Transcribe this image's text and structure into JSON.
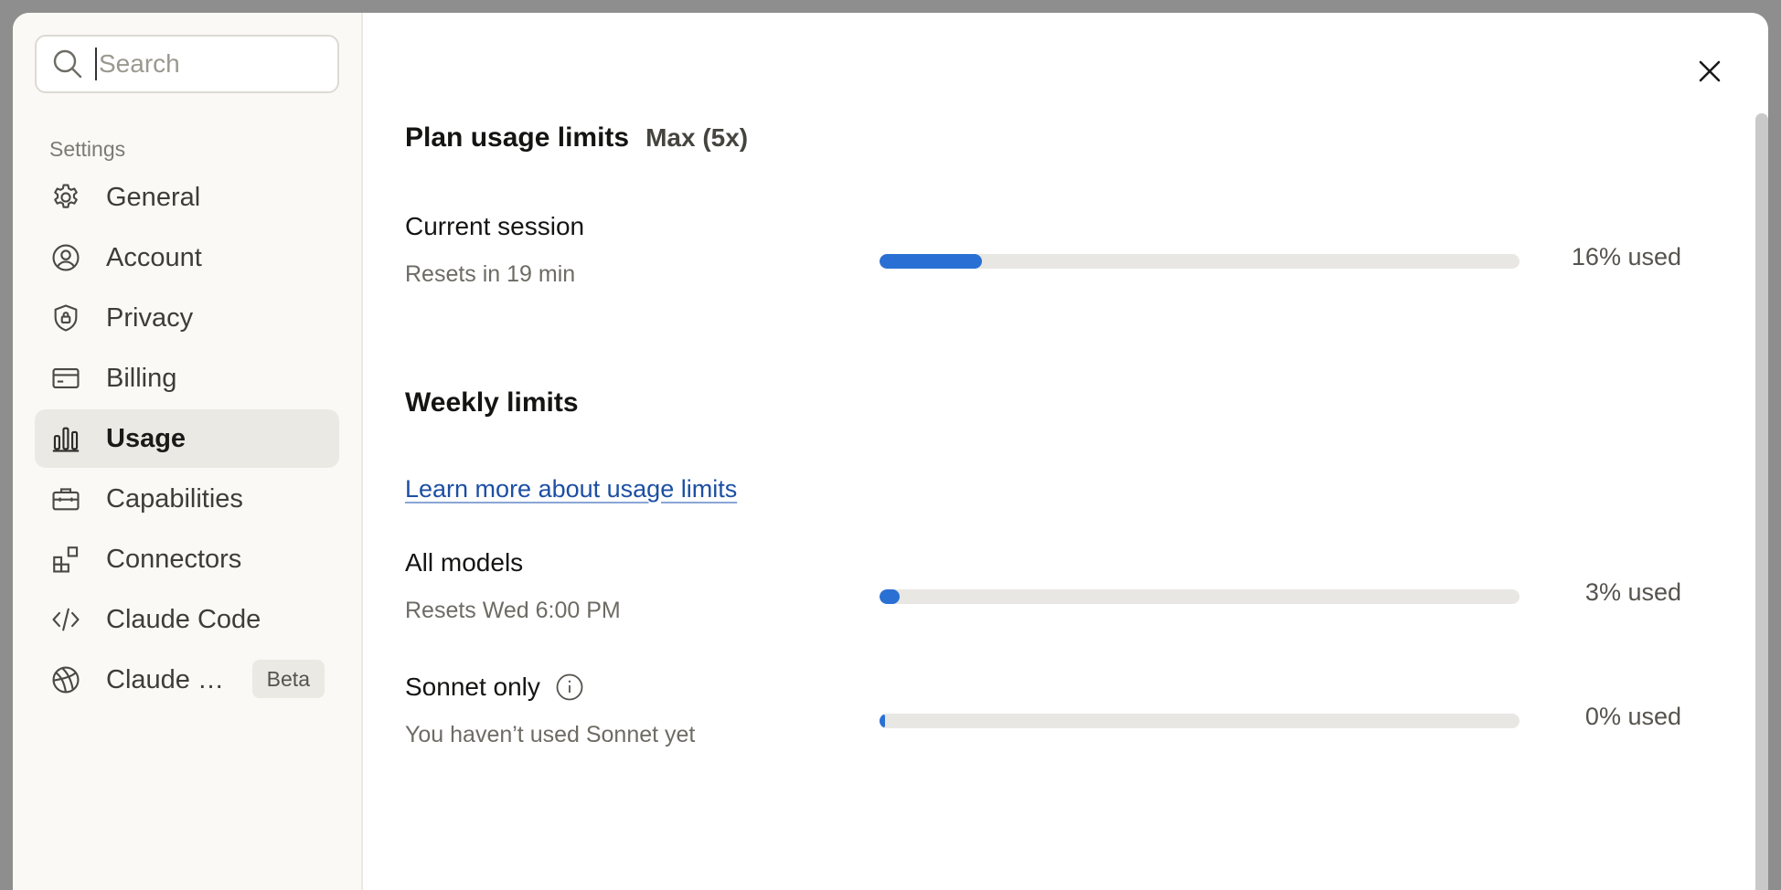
{
  "sidebar": {
    "search_placeholder": "Search",
    "section_label": "Settings",
    "items": [
      {
        "label": "General",
        "icon": "gear-icon"
      },
      {
        "label": "Account",
        "icon": "user-circle-icon"
      },
      {
        "label": "Privacy",
        "icon": "shield-lock-icon"
      },
      {
        "label": "Billing",
        "icon": "credit-card-icon"
      },
      {
        "label": "Usage",
        "icon": "bar-chart-icon",
        "active": true
      },
      {
        "label": "Capabilities",
        "icon": "briefcase-icon"
      },
      {
        "label": "Connectors",
        "icon": "connectors-icon"
      },
      {
        "label": "Claude Code",
        "icon": "code-icon"
      },
      {
        "label": "Claude …",
        "icon": "globe-icon",
        "badge": "Beta"
      }
    ]
  },
  "main": {
    "title": "Plan usage limits",
    "plan": "Max (5x)",
    "current_session": {
      "name": "Current session",
      "sub": "Resets in 19 min",
      "percent": 16,
      "label": "16% used"
    },
    "weekly_title": "Weekly limits",
    "learn_link": "Learn more about usage limits",
    "all_models": {
      "name": "All models",
      "sub": "Resets Wed 6:00 PM",
      "percent": 3,
      "label": "3% used"
    },
    "sonnet_only": {
      "name": "Sonnet only",
      "sub": "You haven’t used Sonnet yet",
      "percent": 0,
      "label": "0% used"
    }
  },
  "colors": {
    "accent": "#2a70d4",
    "link": "#1d4fa3",
    "sidebar_bg": "#faf9f5",
    "active_bg": "#ebe9e3"
  }
}
